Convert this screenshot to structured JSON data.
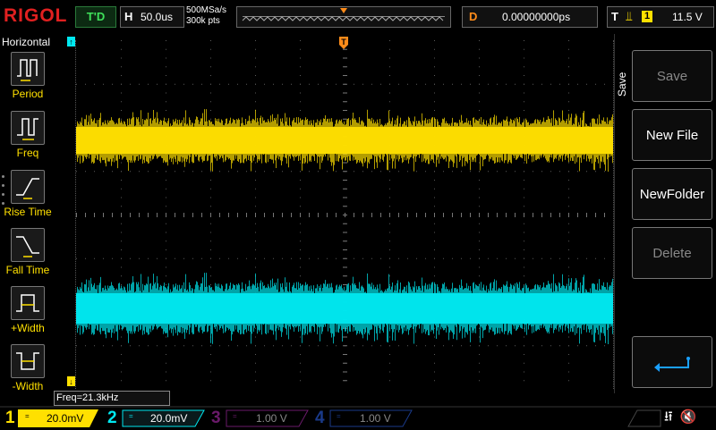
{
  "brand": "RIGOL",
  "top": {
    "trigger_status": "T'D",
    "h_label": "H",
    "timebase": "50.0us",
    "sample_rate": "500MSa/s",
    "memory_depth": "300k pts",
    "d_label": "D",
    "delay": "0.00000000ps",
    "t_label": "T",
    "trigger_source": "1",
    "trigger_level": "11.5 V"
  },
  "left": {
    "title": "Horizontal",
    "items": [
      {
        "label": "Period"
      },
      {
        "label": "Freq"
      },
      {
        "label": "Rise Time"
      },
      {
        "label": "Fall Time"
      },
      {
        "label": "+Width"
      },
      {
        "label": "-Width"
      }
    ]
  },
  "right": {
    "title": "Save",
    "buttons": [
      {
        "label": "Save",
        "enabled": false
      },
      {
        "label": "New File",
        "enabled": true
      },
      {
        "label": "NewFolder",
        "enabled": true
      },
      {
        "label": "Delete",
        "enabled": false
      }
    ]
  },
  "measurement": "Freq=21.3kHz",
  "channels": [
    {
      "num": "1",
      "scale": "20.0mV",
      "color": "#ffe000",
      "active": true
    },
    {
      "num": "2",
      "scale": "20.0mV",
      "color": "#00e8f0",
      "active": true
    },
    {
      "num": "3",
      "scale": "1.00 V",
      "color": "#c020c0",
      "active": false
    },
    {
      "num": "4",
      "scale": "1.00 V",
      "color": "#3060ff",
      "active": false
    }
  ],
  "colors": {
    "ch1": "#ffe000",
    "ch2": "#00e8f0",
    "trigger": "#ff8c1a",
    "brand": "#e02020"
  }
}
